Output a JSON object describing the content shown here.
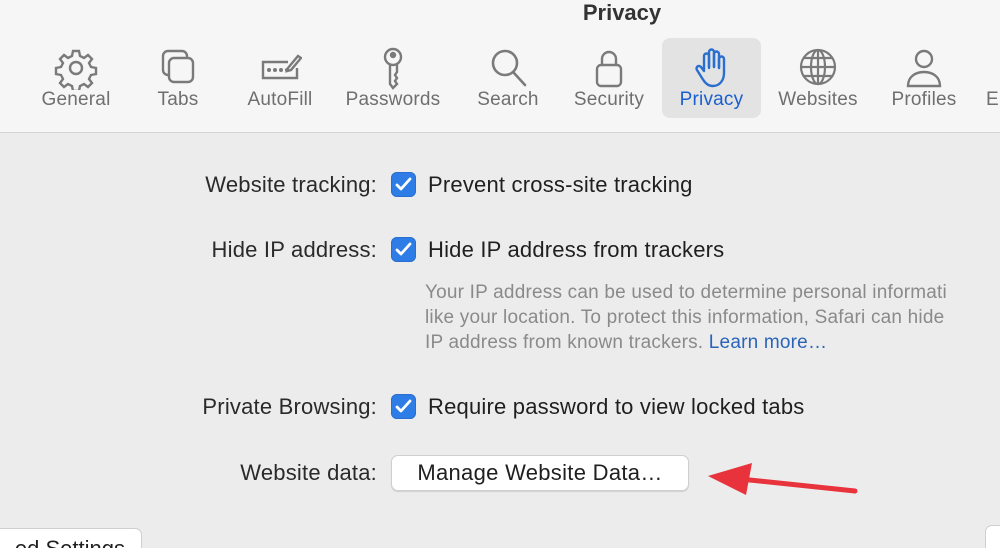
{
  "window": {
    "title": "Privacy"
  },
  "toolbar": {
    "tabs": [
      {
        "label": "General",
        "icon": "gear-icon"
      },
      {
        "label": "Tabs",
        "icon": "tabs-icon"
      },
      {
        "label": "AutoFill",
        "icon": "autofill-icon"
      },
      {
        "label": "Passwords",
        "icon": "key-icon"
      },
      {
        "label": "Search",
        "icon": "search-icon"
      },
      {
        "label": "Security",
        "icon": "lock-icon"
      },
      {
        "label": "Privacy",
        "icon": "hand-icon",
        "active": true
      },
      {
        "label": "Websites",
        "icon": "globe-icon"
      },
      {
        "label": "Profiles",
        "icon": "person-icon"
      },
      {
        "label": "E",
        "icon": ""
      }
    ]
  },
  "privacy": {
    "website_tracking": {
      "label": "Website tracking:",
      "option": "Prevent cross-site tracking",
      "checked": true
    },
    "hide_ip": {
      "label": "Hide IP address:",
      "option": "Hide IP address from trackers",
      "checked": true,
      "description_line1": "Your IP address can be used to determine personal informati",
      "description_line2": "like your location. To protect this information, Safari can hide",
      "description_line3": "IP address from known trackers.",
      "learn_more": "Learn more…"
    },
    "private_browsing": {
      "label": "Private Browsing:",
      "option": "Require password to view locked tabs",
      "checked": true
    },
    "website_data": {
      "label": "Website data:",
      "button": "Manage Website Data…"
    }
  },
  "footer": {
    "advanced_button": "ed Settings"
  },
  "colors": {
    "accent": "#2e7de6",
    "link": "#2a64b8",
    "arrow": "#e8323c"
  }
}
